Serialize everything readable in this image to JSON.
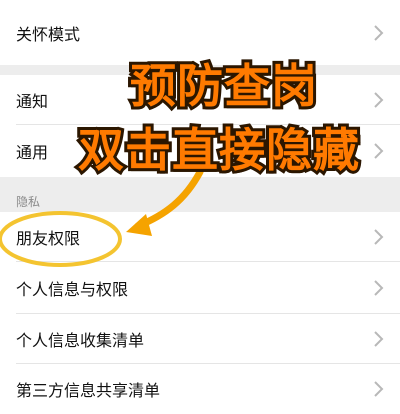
{
  "rows": {
    "care_mode": "关怀模式",
    "notifications": "通知",
    "general": "通用",
    "privacy_section": "隐私",
    "friend_permissions": "朋友权限",
    "personal_info_permissions": "个人信息与权限",
    "personal_info_collection": "个人信息收集清单",
    "third_party_sharing": "第三方信息共享清单"
  },
  "overlay": {
    "line1": "预防查岗",
    "line2": "双击直接隐藏",
    "accent_color": "#ff7a00",
    "highlight_color": "#f4c430",
    "arrow_color": "#f5a300"
  },
  "icons": {
    "row_chevron": "chevron-right-icon"
  }
}
